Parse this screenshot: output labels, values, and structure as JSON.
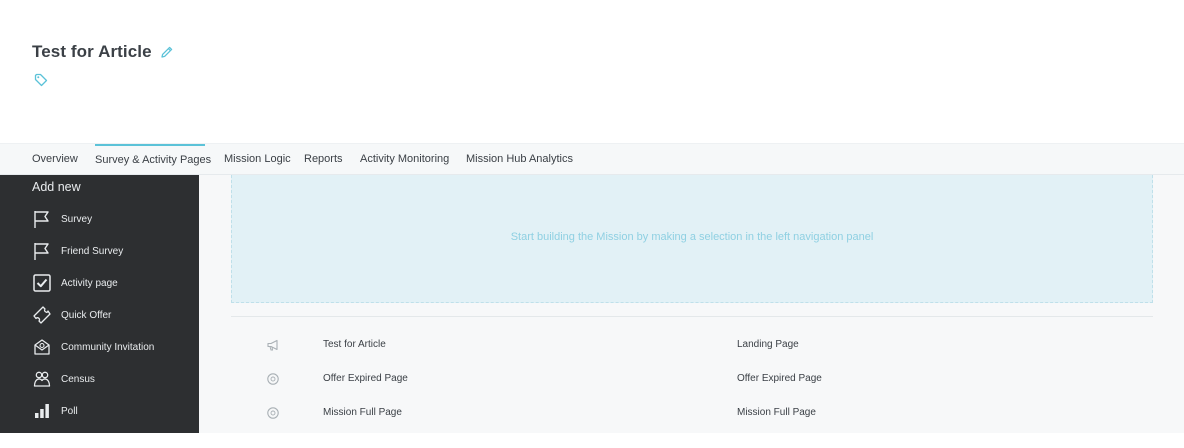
{
  "header": {
    "title": "Test for Article",
    "accent_color": "#5bc2d8"
  },
  "tabs": [
    {
      "label": "Overview",
      "active": false
    },
    {
      "label": "Survey & Activity Pages",
      "active": true
    },
    {
      "label": "Mission Logic",
      "active": false
    },
    {
      "label": "Reports",
      "active": false
    },
    {
      "label": "Activity Monitoring",
      "active": false
    },
    {
      "label": "Mission Hub Analytics",
      "active": false
    }
  ],
  "sidebar": {
    "heading": "Add new",
    "items": [
      {
        "label": "Survey",
        "icon": "flag-icon"
      },
      {
        "label": "Friend Survey",
        "icon": "flag-icon"
      },
      {
        "label": "Activity page",
        "icon": "checkbox-icon"
      },
      {
        "label": "Quick Offer",
        "icon": "ticket-icon"
      },
      {
        "label": "Community Invitation",
        "icon": "envelope-icon"
      },
      {
        "label": "Census",
        "icon": "people-icon"
      },
      {
        "label": "Poll",
        "icon": "bar-chart-icon"
      }
    ]
  },
  "main": {
    "banner_text": "Start building the Mission by making a selection in the left navigation panel",
    "pages": [
      {
        "name": "Test for Article",
        "type": "Landing Page",
        "icon": "megaphone-icon"
      },
      {
        "name": "Offer Expired Page",
        "type": "Offer Expired Page",
        "icon": "circle-icon"
      },
      {
        "name": "Mission Full Page",
        "type": "Mission Full Page",
        "icon": "circle-icon"
      }
    ]
  }
}
